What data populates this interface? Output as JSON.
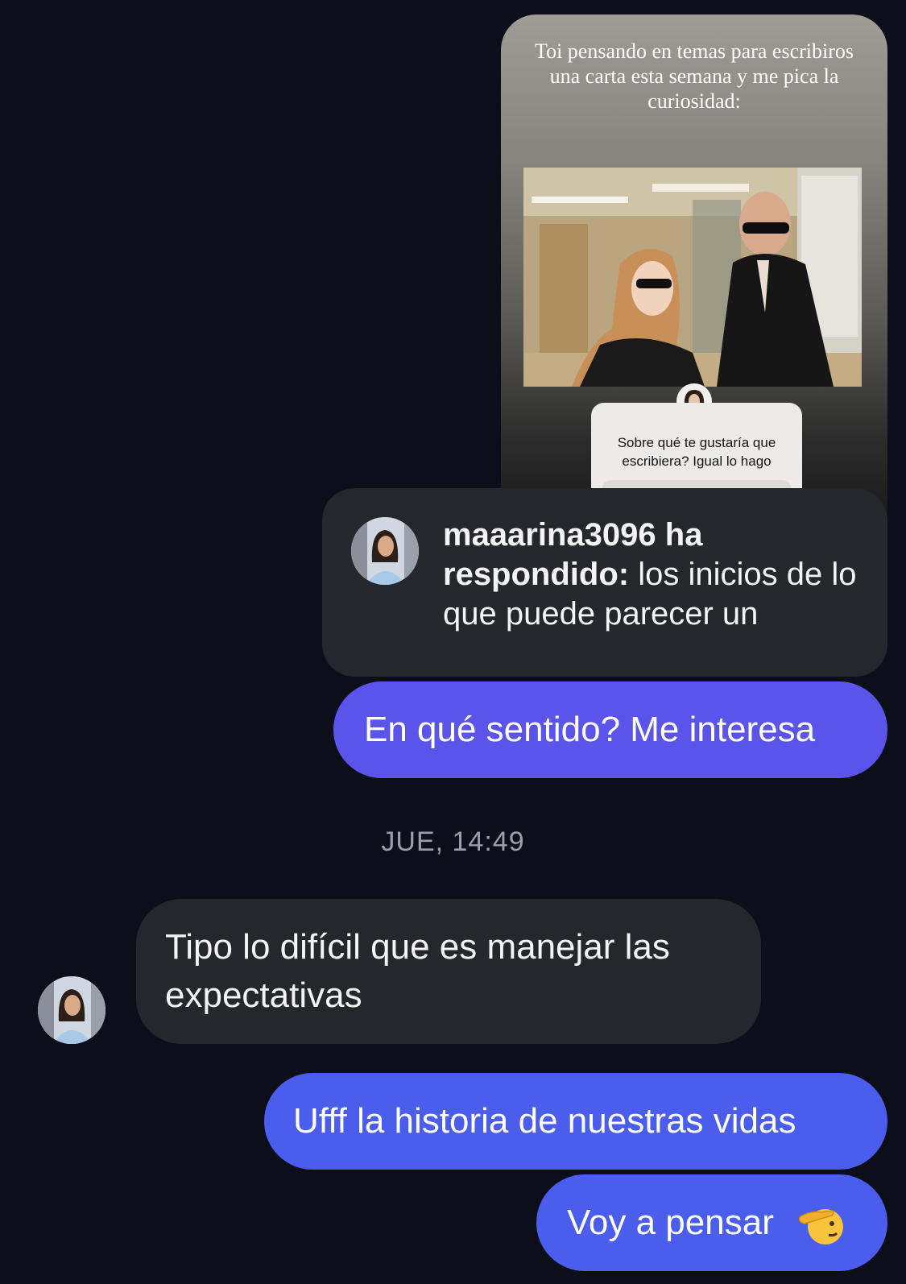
{
  "story": {
    "caption": "Toi pensando en temas para escribiros una carta esta semana y me pica la curiosidad:",
    "question": "Sobre qué te gustaría que escribiera? Igual lo hago"
  },
  "reply": {
    "username": "maaarina3096 ha respondido:",
    "text": " los inicios de lo que puede parecer un"
  },
  "messages": {
    "sent_1": "En qué sentido? Me interesa",
    "timestamp": "JUE, 14:49",
    "received_1": "Tipo lo difícil que es manejar las expectativas",
    "sent_2": "Ufff la historia de nuestras vidas",
    "sent_3": "Voy a pensar"
  },
  "icons": {
    "salute": "saluting-face-emoji",
    "avatar": "profile-photo"
  }
}
